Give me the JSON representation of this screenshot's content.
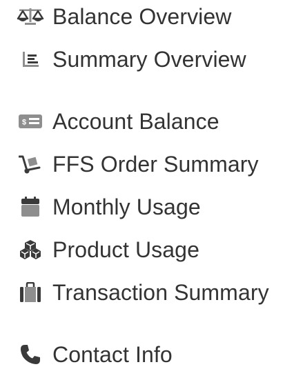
{
  "menu": {
    "items": [
      {
        "label": "Balance Overview",
        "icon": "balance-scale-icon"
      },
      {
        "label": "Summary Overview",
        "icon": "chart-lines-icon"
      },
      {
        "label": "Account Balance",
        "icon": "money-bill-icon"
      },
      {
        "label": "FFS Order Summary",
        "icon": "dolly-cart-icon"
      },
      {
        "label": "Monthly Usage",
        "icon": "calendar-icon"
      },
      {
        "label": "Product Usage",
        "icon": "cubes-icon"
      },
      {
        "label": "Transaction Summary",
        "icon": "suitcase-icon"
      },
      {
        "label": "Contact Info",
        "icon": "phone-icon"
      }
    ],
    "colors": {
      "text": "#333333",
      "icon_dark": "#3a3a3a",
      "icon_gray": "#8e8e8e"
    }
  }
}
